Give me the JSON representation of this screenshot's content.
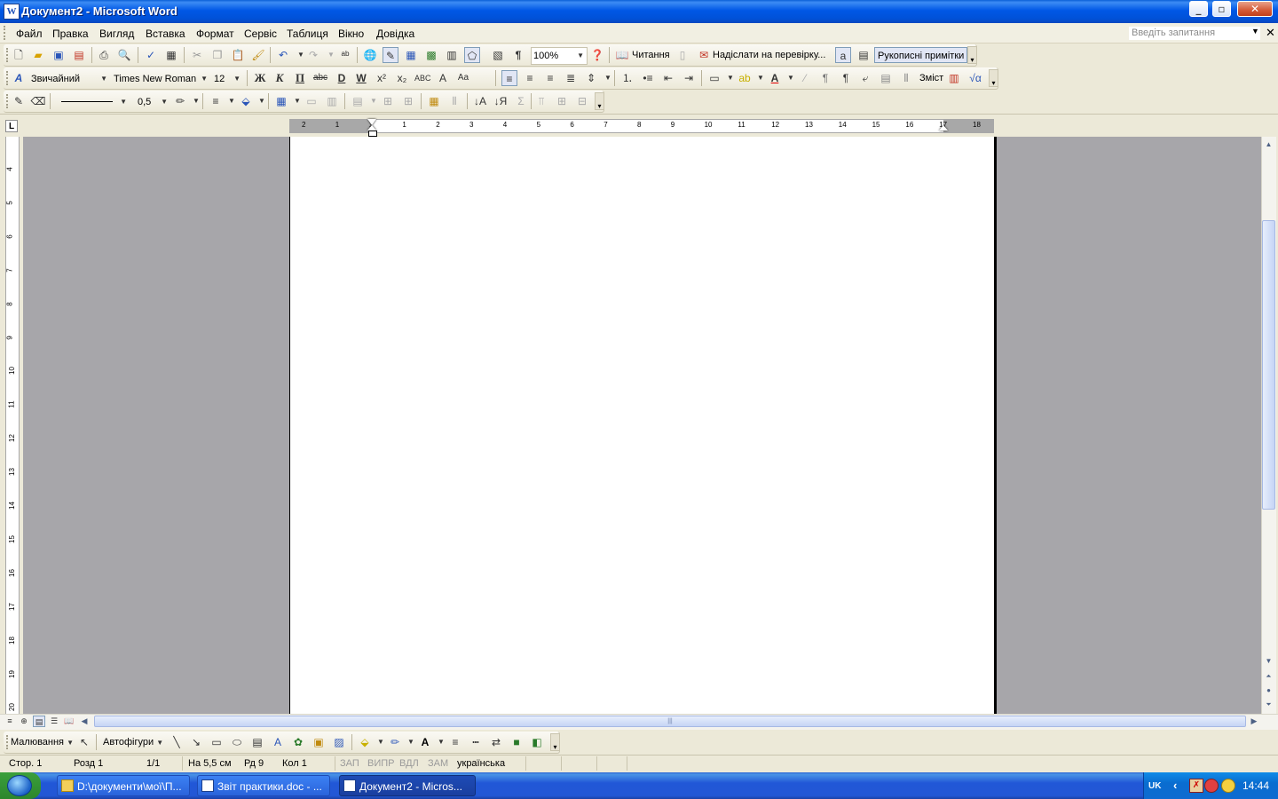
{
  "window": {
    "title": "Документ2 - Microsoft Word",
    "app_icon": "W",
    "minimize": "_",
    "maximize": "▫",
    "close": "✕"
  },
  "menu": {
    "items": [
      "Файл",
      "Правка",
      "Вигляд",
      "Вставка",
      "Формат",
      "Сервіс",
      "Таблиця",
      "Вікно",
      "Довідка"
    ],
    "help_placeholder": "Введіть запитання"
  },
  "standard_toolbar": {
    "zoom": "100%",
    "reading_label": "Читання",
    "send_review_label": "Надіслати на перевірку...",
    "ink_annotations_label": "Рукописні примітки"
  },
  "formatting_toolbar": {
    "style": "Звичайний",
    "font": "Times New Roman",
    "size": "12",
    "bold": "Ж",
    "italic": "К",
    "underline": "П",
    "toc_label": "Зміст"
  },
  "tables_toolbar": {
    "line_weight": "0,5"
  },
  "ruler": {
    "h_labels": [
      "2",
      "1",
      "1",
      "1",
      "2",
      "3",
      "4",
      "5",
      "6",
      "7",
      "8",
      "9",
      "10",
      "11",
      "12",
      "13",
      "14",
      "15",
      "16",
      "17",
      "18"
    ],
    "v_labels": [
      "4",
      "5",
      "6",
      "7",
      "8",
      "9",
      "10",
      "11",
      "12",
      "13",
      "14",
      "15",
      "16",
      "17",
      "18",
      "19",
      "20"
    ],
    "corner": "L"
  },
  "drawing_toolbar": {
    "drawing_label": "Малювання",
    "autoshapes_label": "Автофігури"
  },
  "status": {
    "page": "Стор. 1",
    "section": "Розд 1",
    "pages": "1/1",
    "at": "На 5,5 см",
    "line": "Рд 9",
    "col": "Кол 1",
    "rec": "ЗАП",
    "trk": "ВИПР",
    "ext": "ВДЛ",
    "ovr": "ЗАМ",
    "language": "українська"
  },
  "taskbar": {
    "tasks": [
      {
        "label": "D:\\документи\\мої\\П...",
        "icon": "folder-icon"
      },
      {
        "label": "Звіт практики.doc - ...",
        "icon": "word-icon"
      },
      {
        "label": "Документ2 - Micros...",
        "icon": "word-icon"
      }
    ],
    "lang": "UK",
    "clock": "14:44"
  },
  "colors": {
    "titlebar": "#0058E6",
    "workspace": "#A7A6AA",
    "taskbar": "#2257D5",
    "start": "#2C862C"
  }
}
